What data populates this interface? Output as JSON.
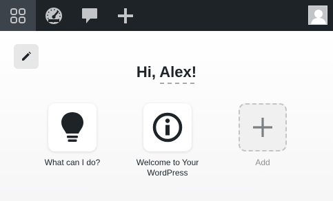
{
  "topbar": {
    "items": [
      {
        "icon": "grid-icon"
      },
      {
        "icon": "dashboard-icon"
      },
      {
        "icon": "comment-icon"
      },
      {
        "icon": "plus-icon"
      }
    ],
    "avatar": "user-avatar"
  },
  "main": {
    "edit_icon": "pencil-icon",
    "greeting": "Hi, Alex!",
    "tiles": [
      {
        "label": "What can I do?",
        "icon": "lightbulb-icon"
      },
      {
        "label": "Welcome to Your WordPress",
        "icon": "info-icon"
      },
      {
        "label": "Add",
        "icon": "plus-icon"
      }
    ]
  },
  "colors": {
    "topbar_bg": "#1d2327",
    "active_bg": "#3c434a",
    "icon_light": "#c3c4c7",
    "text_dark": "#1d2327",
    "muted": "#8c8f94"
  }
}
